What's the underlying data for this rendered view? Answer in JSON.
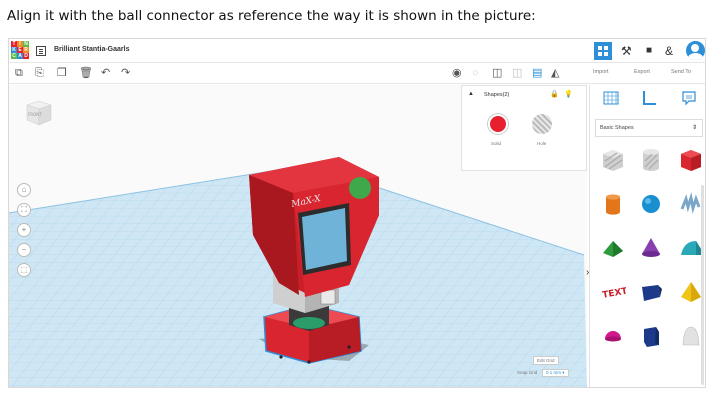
{
  "instruction": "Align it with the ball connector as reference the way it is shown in the picture:",
  "header": {
    "logo_letters": [
      "TIN",
      "KER",
      "CAD"
    ],
    "project_name": "Brilliant Stantia-Gaarls"
  },
  "toolbar": {
    "import_label": "Import",
    "export_label": "Export",
    "send_to_label": "Send To"
  },
  "viewcube": {
    "face_label": "FRONT"
  },
  "nav": [
    "⌂",
    "⛶",
    "+",
    "−",
    "⬚"
  ],
  "shapes_panel": {
    "title": "Shapes(2)",
    "solid_label": "Solid",
    "hole_label": "Hole",
    "solid_color": "#e8202e"
  },
  "model": {
    "label_text": "MaX-X"
  },
  "grid": {
    "edit_grid_label": "Edit Grid",
    "snap_grid_label": "Snap Grid",
    "snap_grid_value": "0.1 mm ▾"
  },
  "library": {
    "category": "Basic Shapes",
    "shapes": [
      "box-hole",
      "cylinder-hole",
      "box",
      "cylinder",
      "sphere",
      "scribble",
      "roof",
      "cone",
      "round-roof",
      "text",
      "wedge",
      "pyramid",
      "half-sphere",
      "polygon",
      "paraboloid"
    ]
  },
  "colors": {
    "accent": "#2d8fd8",
    "model_red": "#d9252f",
    "workplane": "#cfe7f5"
  }
}
